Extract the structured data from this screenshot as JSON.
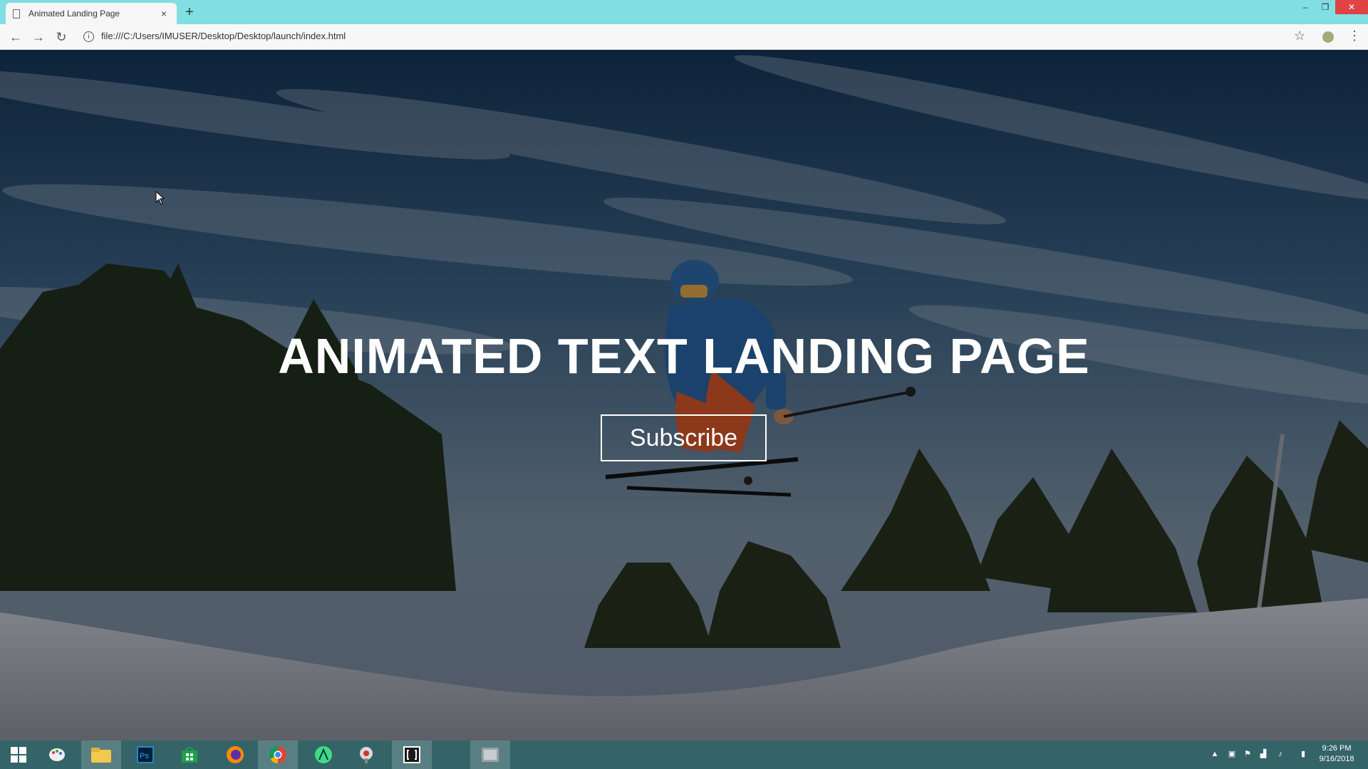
{
  "browser": {
    "tab_title": "Animated Landing Page",
    "tab_close_label": "×",
    "new_tab_label": "+",
    "url": "file:///C:/Users/IMUSER/Desktop/Desktop/launch/index.html",
    "window_controls": {
      "minimize": "–",
      "maximize": "❐",
      "close": "✕"
    }
  },
  "page": {
    "headline": "ANIMATED TEXT LANDING PAGE",
    "subscribe_label": "Subscribe"
  },
  "taskbar": {
    "time": "9:26 PM",
    "date": "9/16/2018",
    "apps": [
      "start-icon",
      "paint-icon",
      "file-explorer-icon",
      "photoshop-icon",
      "store-icon",
      "firefox-icon",
      "chrome-icon",
      "android-studio-icon",
      "tool-icon",
      "brackets-icon",
      "window-icon"
    ]
  }
}
